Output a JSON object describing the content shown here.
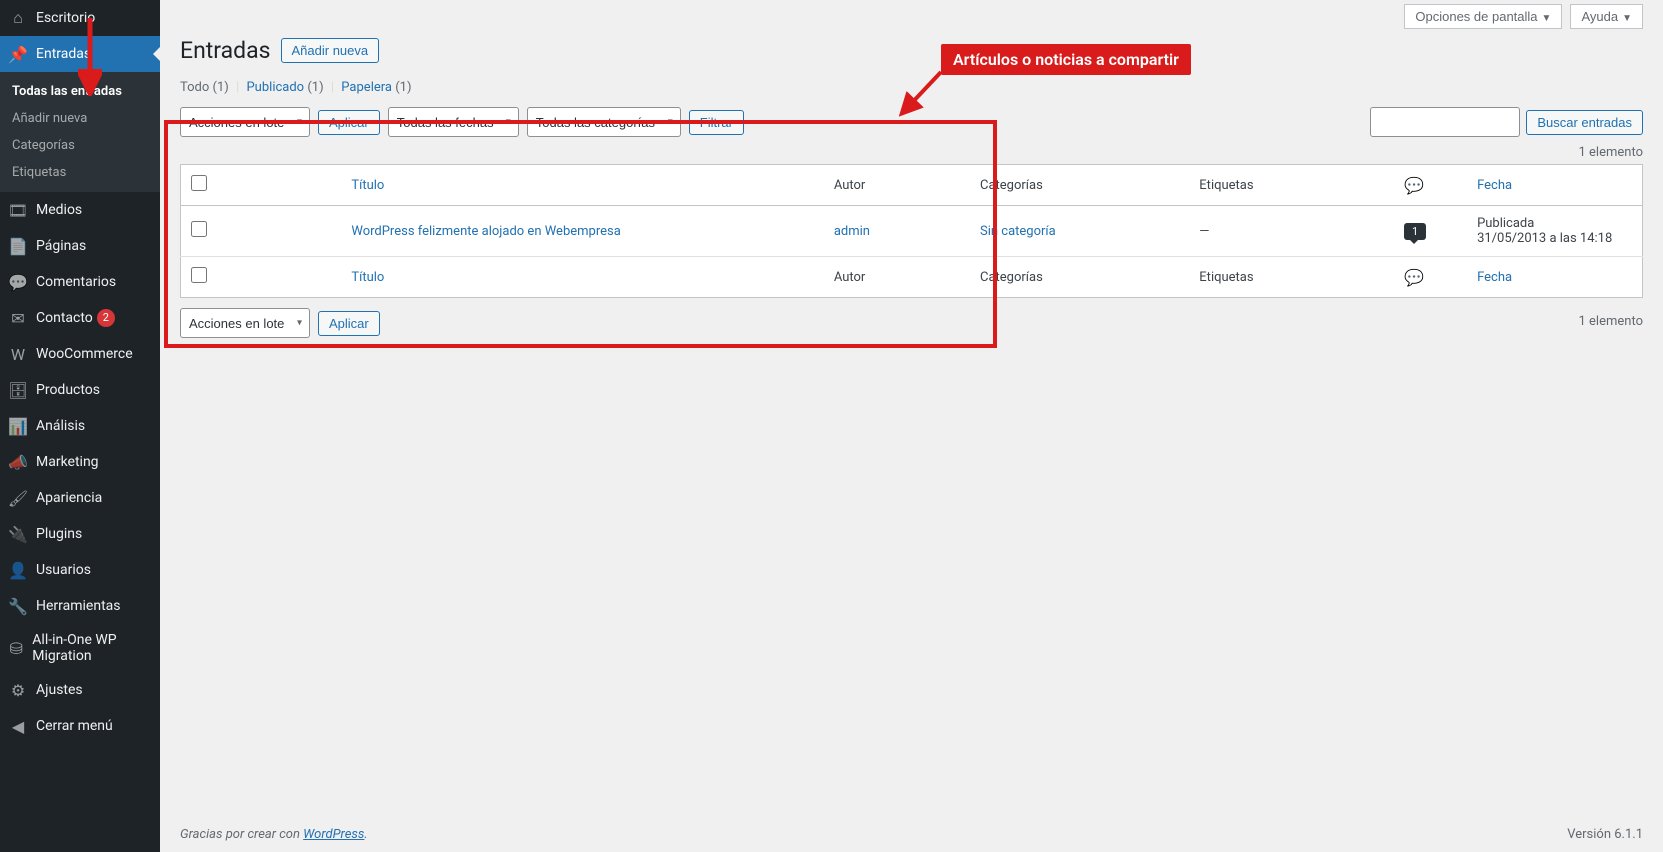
{
  "sidebar": {
    "items": [
      {
        "label": "Escritorio",
        "icon": "dashboard-icon"
      },
      {
        "label": "Entradas",
        "icon": "pin-icon",
        "active": true,
        "submenu": [
          {
            "label": "Todas las entradas",
            "current": true
          },
          {
            "label": "Añadir nueva"
          },
          {
            "label": "Categorías"
          },
          {
            "label": "Etiquetas"
          }
        ]
      },
      {
        "label": "Medios",
        "icon": "media-icon"
      },
      {
        "label": "Páginas",
        "icon": "page-icon"
      },
      {
        "label": "Comentarios",
        "icon": "comment-icon"
      },
      {
        "label": "Contacto",
        "icon": "mail-icon",
        "badge": "2"
      },
      {
        "label": "WooCommerce",
        "icon": "woo-icon"
      },
      {
        "label": "Productos",
        "icon": "product-icon"
      },
      {
        "label": "Análisis",
        "icon": "analytics-icon"
      },
      {
        "label": "Marketing",
        "icon": "megaphone-icon"
      },
      {
        "label": "Apariencia",
        "icon": "brush-icon"
      },
      {
        "label": "Plugins",
        "icon": "plugin-icon"
      },
      {
        "label": "Usuarios",
        "icon": "user-icon"
      },
      {
        "label": "Herramientas",
        "icon": "tools-icon"
      },
      {
        "label": "All-in-One WP Migration",
        "icon": "migration-icon"
      },
      {
        "label": "Ajustes",
        "icon": "settings-icon"
      },
      {
        "label": "Cerrar menú",
        "icon": "collapse-icon"
      }
    ]
  },
  "topbar": {
    "screen_options": "Opciones de pantalla",
    "help": "Ayuda"
  },
  "header": {
    "title": "Entradas",
    "add_new": "Añadir nueva"
  },
  "subsub": {
    "all_label": "Todo",
    "all_count": "(1)",
    "published_label": "Publicado",
    "published_count": "(1)",
    "trash_label": "Papelera",
    "trash_count": "(1)"
  },
  "filters": {
    "bulk": "Acciones en lote",
    "apply": "Aplicar",
    "dates": "Todas las fechas",
    "categories": "Todas las categorías",
    "filter": "Filtrar",
    "search_btn": "Buscar entradas"
  },
  "count_text": "1 elemento",
  "table": {
    "cols": {
      "title": "Título",
      "author": "Autor",
      "cat": "Categorías",
      "tag": "Etiquetas",
      "date": "Fecha"
    },
    "rows": [
      {
        "title": "WordPress felizmente alojado en Webempresa",
        "author": "admin",
        "cat": "Sin categoría",
        "tag": "—",
        "comments": "1",
        "status": "Publicada",
        "date": "31/05/2013 a las 14:18"
      }
    ]
  },
  "footer": {
    "thanks": "Gracias por crear con ",
    "wp": "WordPress",
    "period": ".",
    "version": "Versión 6.1.1"
  },
  "annotation": {
    "label": "Artículos o noticias a compartir"
  }
}
